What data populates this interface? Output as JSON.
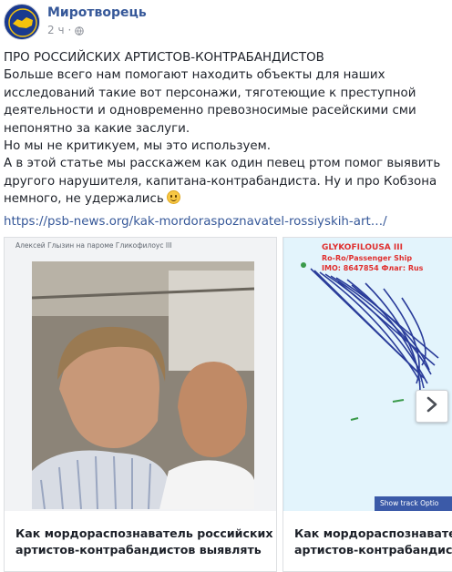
{
  "header": {
    "page_name": "Миротворець",
    "time": "2 ч",
    "privacy_icon": "globe-icon"
  },
  "post": {
    "lines": [
      "ПРО РОССИЙСКИХ АРТИСТОВ-КОНТРАБАНДИСТОВ",
      "Больше всего нам помогают находить объекты для наших",
      "исследований такие вот персонажи, тяготеющие к преступной",
      "деятельности и одновременно превозносимые расейскими сми",
      "непонятно за какие заслуги.",
      "Но мы не критикуем, мы это используем.",
      "А в этой статье мы расскажем как один певец ртом помог выявить",
      "другого нарушителя, капитана-контрабандиста. Ну и про Кобзона",
      "немного, не удержались"
    ],
    "emoji": "smile-emoji",
    "link": "https://psb-news.org/kak-mordoraspoznavatel-rossiyskih-art…/"
  },
  "cards": [
    {
      "photo_caption": "Алексей Глызин на пароме Гликофилоус III",
      "title_lines": [
        "Как мордораспознаватель российских",
        "артистов-контрабандистов выявлять"
      ]
    },
    {
      "map_title": "GLYKOFILOUSA III",
      "map_line1": "Ro-Ro/Passenger Ship",
      "map_line2": "IMO: 8647854 Флаг: Rus",
      "track_button": "Show track Optio",
      "title_lines": [
        "Как мордораспознаватель российс",
        "артистов-контрабандистов выявл"
      ]
    }
  ],
  "carousel": {
    "next_icon": "chevron-right-icon"
  },
  "colors": {
    "link": "#365899",
    "text": "#1d2129",
    "meta": "#90949c",
    "map_sea": "#e3f4fc",
    "track": "#2a3c9a"
  }
}
